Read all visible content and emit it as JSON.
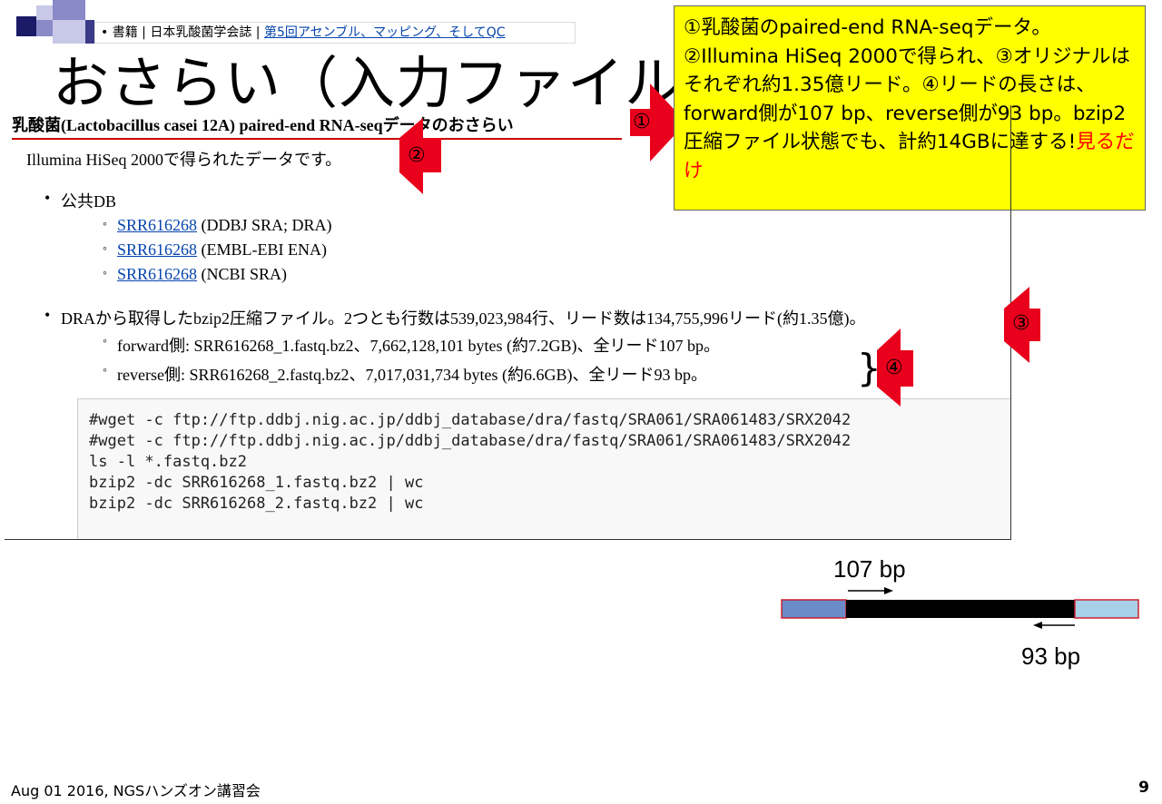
{
  "breadcrumb": {
    "bullet": "•",
    "prefix": "書籍 | 日本乳酸菌学会誌 | ",
    "link": "第5回アセンブル、マッピング、そしてQC"
  },
  "slide_title": "おさらい（入力ファイル）",
  "callout": {
    "text": "①乳酸菌のpaired-end RNA-seqデータ。②Illumina HiSeq 2000で得られ、③オリジナルはそれぞれ約1.35億リード。④リードの長さは、forward側が107 bp、reverse側が93 bp。bzip2圧縮ファイル状態でも、計約14GBに達する!",
    "highlight": "見るだけ"
  },
  "panel": {
    "heading": "乳酸菌(Lactobacillus casei 12A) paired-end RNA-seqデータのおさらい",
    "intro": "Illumina HiSeq 2000で得られたデータです。",
    "public_db_label": "公共DB",
    "db_links": [
      {
        "link": "SRR616268",
        "suffix": " (DDBJ SRA; DRA)"
      },
      {
        "link": "SRR616268",
        "suffix": " (EMBL-EBI ENA)"
      },
      {
        "link": "SRR616268",
        "suffix": " (NCBI SRA)"
      }
    ],
    "dra_text": "DRAから取得したbzip2圧縮ファイル。2つとも行数は539,023,984行、リード数は134,755,996リード(約1.35億)。",
    "files": [
      "forward側: SRR616268_1.fastq.bz2、7,662,128,101 bytes (約7.2GB)、全リード107 bp。",
      "reverse側: SRR616268_2.fastq.bz2、7,017,031,734 bytes (約6.6GB)、全リード93 bp。"
    ],
    "code_lines": [
      "#wget -c ftp://ftp.ddbj.nig.ac.jp/ddbj_database/dra/fastq/SRA061/SRA061483/SRX2042",
      "#wget -c ftp://ftp.ddbj.nig.ac.jp/ddbj_database/dra/fastq/SRA061/SRA061483/SRX2042",
      "ls -l *.fastq.bz2",
      "bzip2 -dc SRR616268_1.fastq.bz2 | wc",
      "bzip2 -dc SRR616268_2.fastq.bz2 | wc"
    ]
  },
  "markers": [
    "①",
    "②",
    "③",
    "④"
  ],
  "diagram": {
    "forward_label": "107 bp",
    "reverse_label": "93 bp"
  },
  "footer": {
    "left": "Aug 01 2016, NGSハンズオン講習会",
    "page": "9"
  },
  "colors": {
    "callout_bg": "#ffff00",
    "arrow": "#e8001c",
    "link": "#0645ad"
  }
}
